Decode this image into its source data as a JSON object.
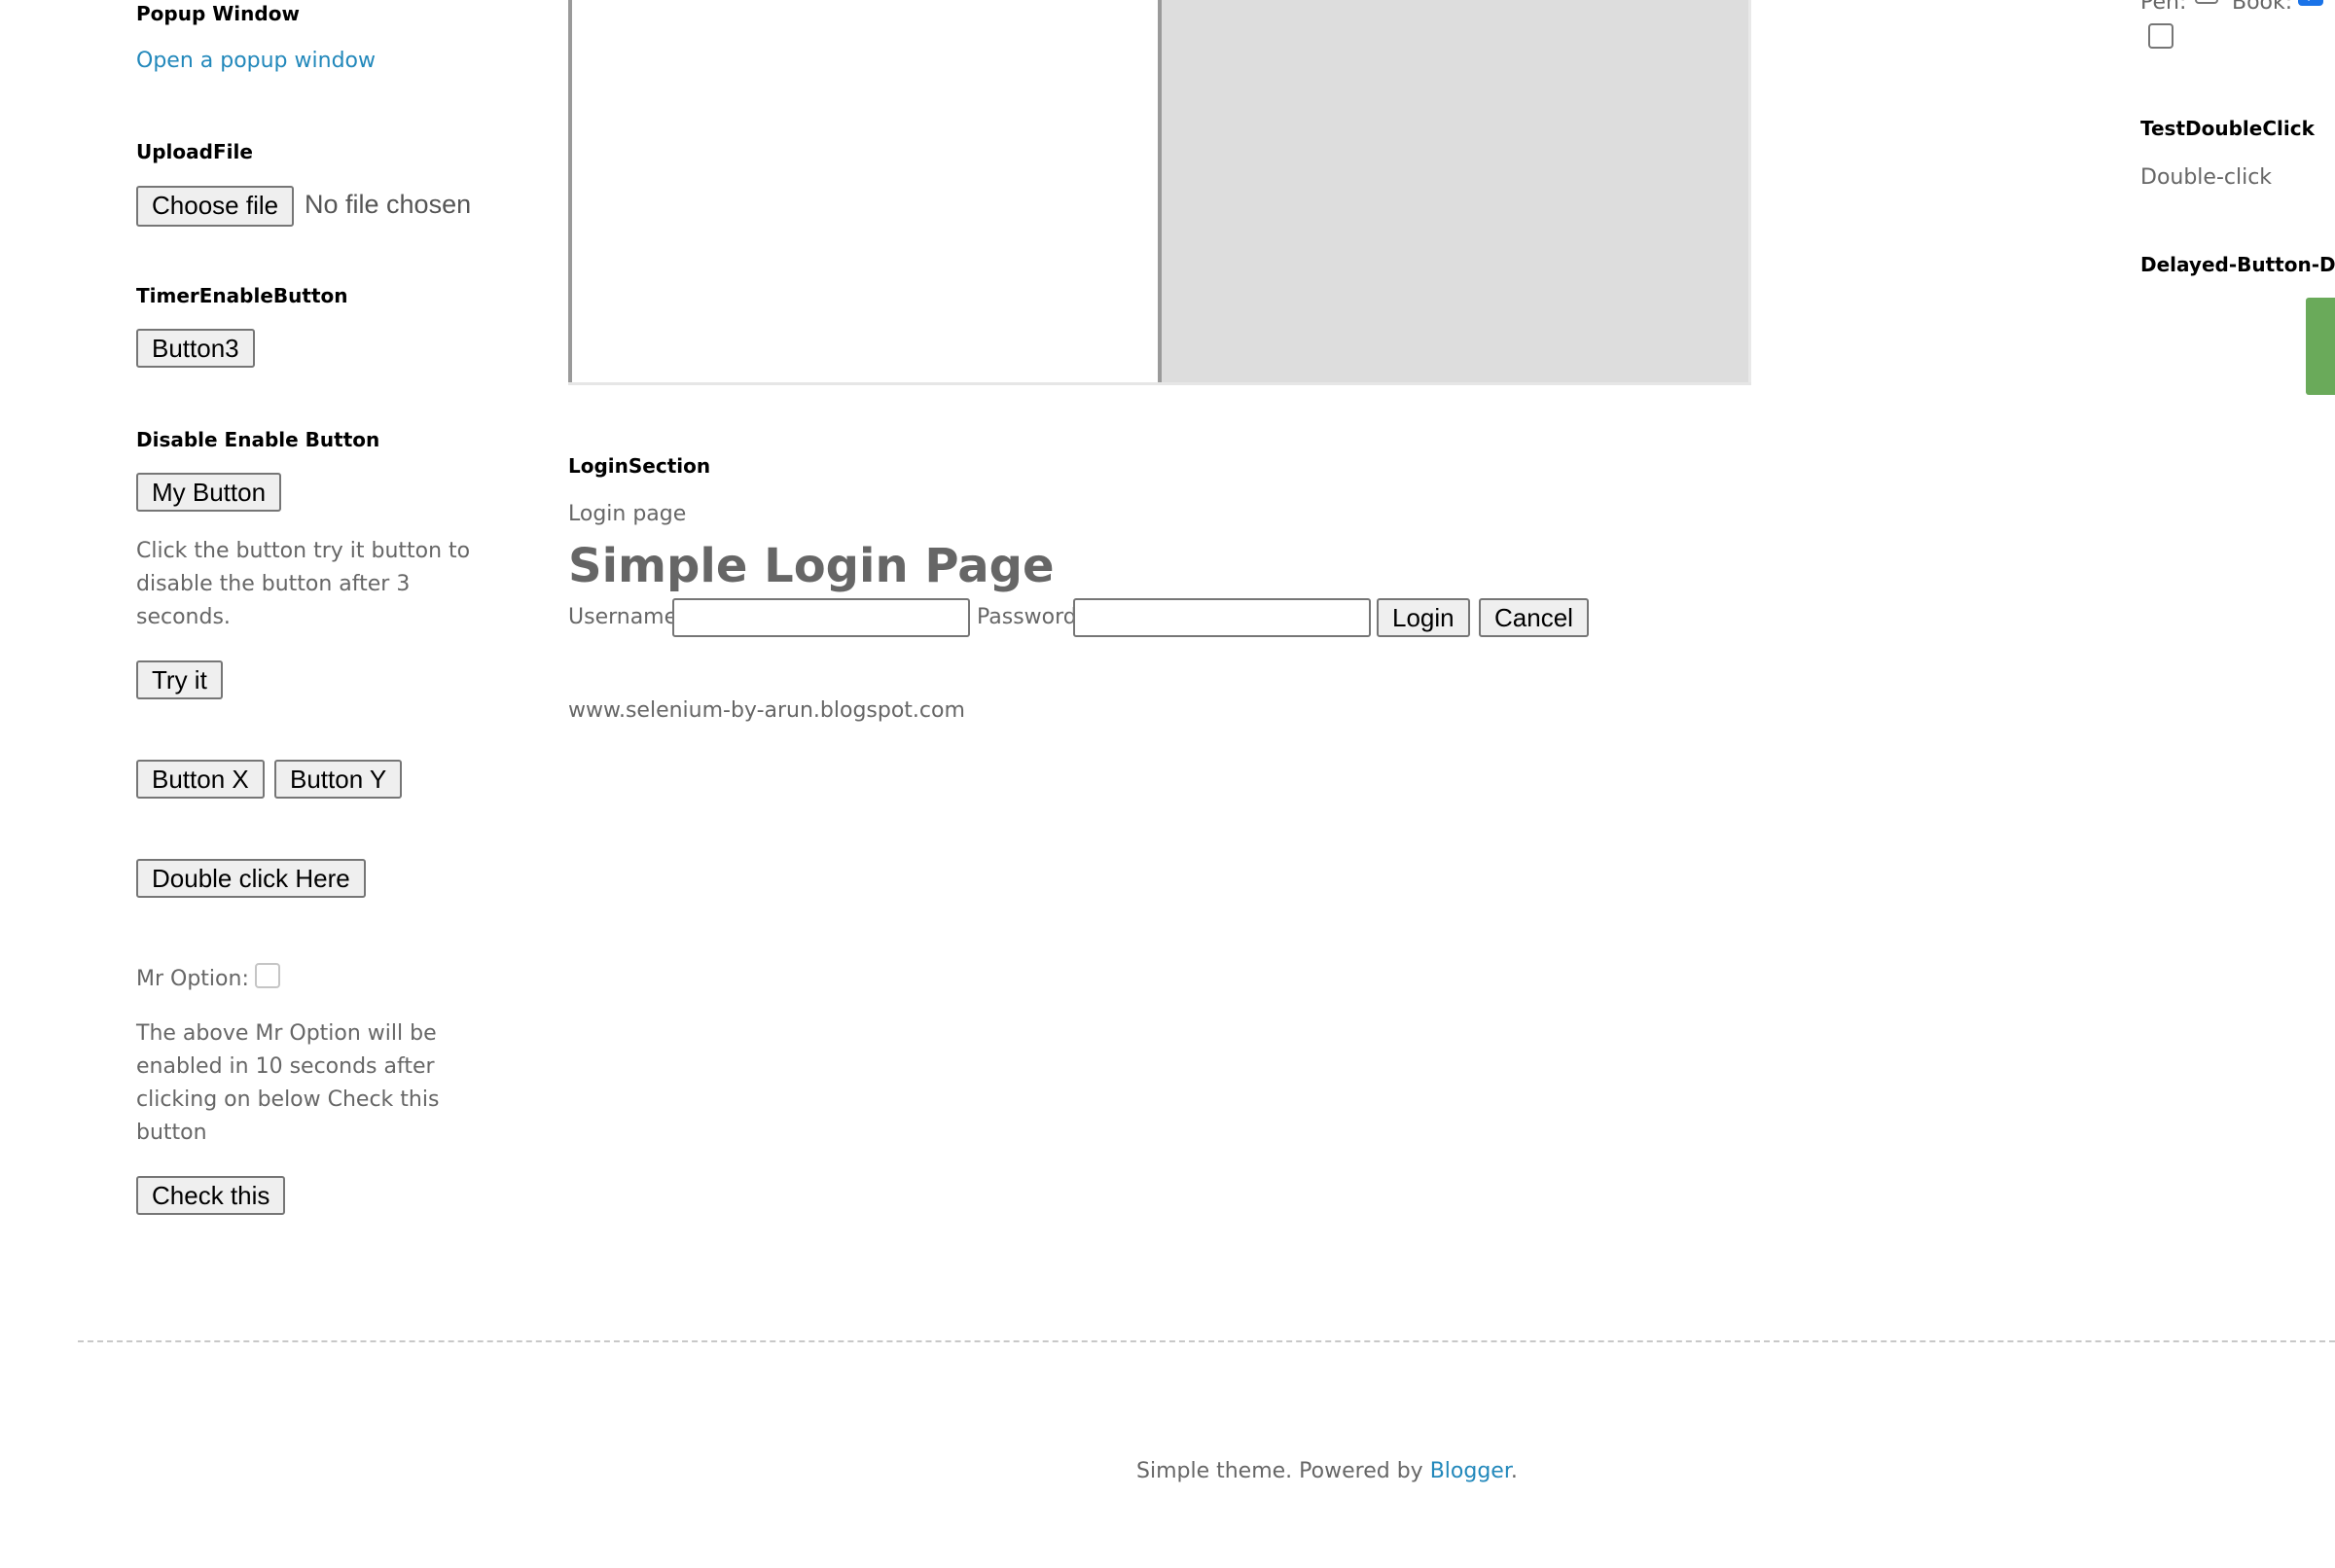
{
  "left_column": {
    "popup": {
      "title": "Popup Window",
      "link": "Open a popup window"
    },
    "upload": {
      "title": "UploadFile",
      "button": "Choose file",
      "status": "No file chosen"
    },
    "timer": {
      "title": "TimerEnableButton",
      "button": "Button3"
    },
    "disable_enable": {
      "title": "Disable Enable Button",
      "button": "My Button",
      "description": "Click the button try it button to disable the button after 3 seconds.",
      "try_button": "Try it"
    },
    "buttons_xy": {
      "button_x": "Button X",
      "button_y": "Button Y"
    },
    "double_click": {
      "button": "Double click Here"
    },
    "mr_option": {
      "label": "Mr Option:",
      "description": "The above Mr Option will be enabled in 10 seconds after clicking on below Check this button",
      "button": "Check this"
    }
  },
  "login_section": {
    "title": "LoginSection",
    "subtitle": "Login page",
    "heading": "Simple Login Page",
    "username_label": "Username",
    "password_label": "Password",
    "login_button": "Login",
    "cancel_button": "Cancel",
    "site_url": "www.selenium-by-arun.blogspot.com"
  },
  "right_column": {
    "items_row": {
      "pen_label": "Pen:",
      "book_label": "Book:"
    },
    "double_click": {
      "title": "TestDoubleClick",
      "text": "Double-click"
    },
    "delayed": {
      "title": "Delayed-Button-Dro"
    }
  },
  "footer": {
    "text": "Simple theme. Powered by",
    "link": "Blogger",
    "period": "."
  },
  "colors": {
    "link": "#2288bb",
    "text": "#666666",
    "green_button": "#6aaa5a",
    "frame_grey": "#dddddd"
  }
}
